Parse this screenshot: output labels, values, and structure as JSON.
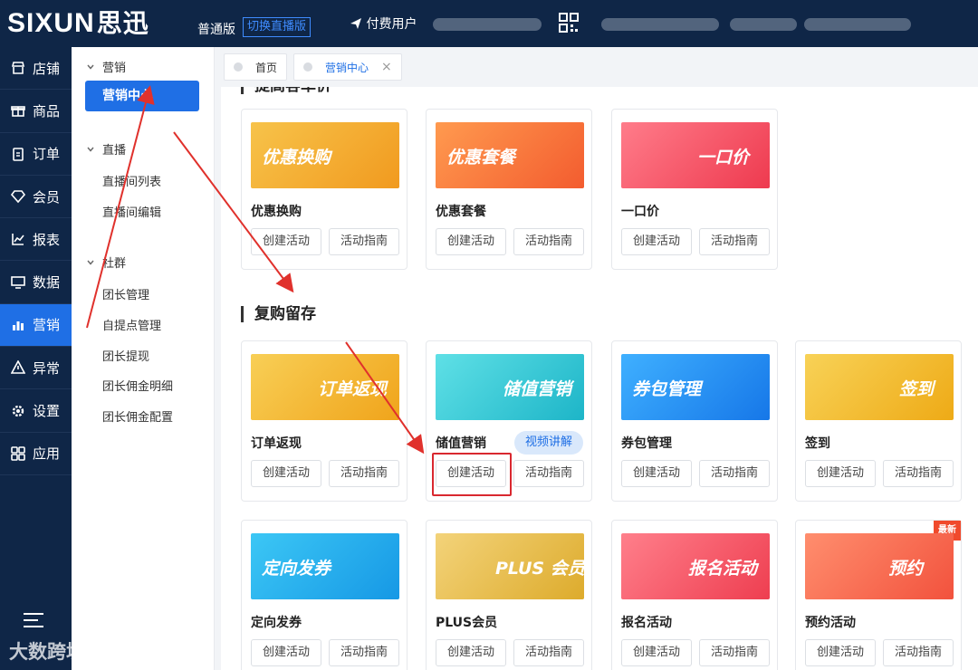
{
  "topbar": {
    "logo": "SIXUN",
    "logo_cn": "思迅",
    "edition": "普通版",
    "switch_label": "切换直播版",
    "paid_user": "付费用户"
  },
  "leftnav": {
    "items": [
      {
        "label": "店铺",
        "icon": "store-icon"
      },
      {
        "label": "商品",
        "icon": "gift-icon"
      },
      {
        "label": "订单",
        "icon": "clipboard-icon"
      },
      {
        "label": "会员",
        "icon": "diamond-icon"
      },
      {
        "label": "报表",
        "icon": "chart-icon"
      },
      {
        "label": "数据",
        "icon": "monitor-icon"
      },
      {
        "label": "营销",
        "icon": "bar-chart-icon"
      },
      {
        "label": "异常",
        "icon": "warning-icon"
      },
      {
        "label": "设置",
        "icon": "gear-icon"
      },
      {
        "label": "应用",
        "icon": "apps-icon"
      }
    ],
    "active": "营销",
    "watermark": "大数跨境"
  },
  "subnav": {
    "groups": [
      {
        "title": "营销",
        "items": [
          "营销中心"
        ]
      },
      {
        "title": "直播",
        "items": [
          "直播间列表",
          "直播间编辑"
        ]
      },
      {
        "title": "社群",
        "items": [
          "团长管理",
          "自提点管理",
          "团长提现",
          "团长佣金明细",
          "团长佣金配置"
        ]
      }
    ],
    "active_item": "营销中心"
  },
  "tabs": [
    {
      "label": "首页",
      "closable": false
    },
    {
      "label": "营销中心",
      "closable": true,
      "close": "×"
    }
  ],
  "sections": {
    "section1_title_partial": "提高客单价",
    "section2_title": "复购留存"
  },
  "buttons": {
    "create": "创建活动",
    "guide": "活动指南",
    "video": "视频讲解"
  },
  "cards_row1": [
    {
      "name": "优惠换购",
      "banner": "优惠换购",
      "color": "#f5a623"
    },
    {
      "name": "优惠套餐",
      "banner": "优惠套餐",
      "color": "#f6743a"
    },
    {
      "name": "一口价",
      "banner": "一口价",
      "color": "#f04a5c"
    }
  ],
  "cards_row2": [
    {
      "name": "订单返现",
      "banner": "订单返现",
      "color": "#f3b21c"
    },
    {
      "name": "储值营销",
      "banner": "储值营销",
      "color": "#2ec7d4"
    },
    {
      "name": "券包管理",
      "banner": "券包管理",
      "color": "#1d8ff0"
    },
    {
      "name": "签到",
      "banner": "签到",
      "color": "#f3b21c"
    }
  ],
  "cards_row3": [
    {
      "name": "定向发券",
      "banner": "定向发券",
      "color": "#18a9e8"
    },
    {
      "name": "PLUS会员",
      "banner": "PLUS 会员",
      "color": "#e9bd45"
    },
    {
      "name": "报名活动",
      "banner": "报名活动",
      "color": "#f25160"
    },
    {
      "name": "预约活动",
      "banner": "预约",
      "color": "#f46d4a",
      "badge": "最新"
    }
  ]
}
